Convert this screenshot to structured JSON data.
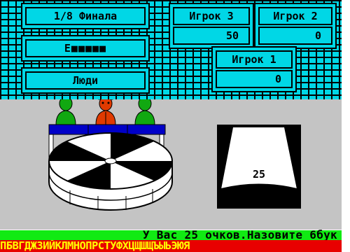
{
  "header": {
    "round": "1/8 Финала",
    "word": "Е■■■■■",
    "topic": "Люди"
  },
  "players": [
    {
      "label": "Игрок 3",
      "score": "50"
    },
    {
      "label": "Игрок 2",
      "score": "0"
    },
    {
      "label": "Игрок 1",
      "score": "0"
    }
  ],
  "drum": {
    "sector_value": "25"
  },
  "status": {
    "message": "У Вас 25 очков.Назовите 6бук"
  },
  "alphabet": "ПБВГДЖЗИЙКЛМНОПРСТУФХЦЩШЩЪЫЬЭЮЯ",
  "colors": {
    "grid_cyan": "#00d7e6",
    "floor_gray": "#c4c4c4",
    "player_green": "#11a811",
    "host_red": "#e03a00",
    "stand_blue": "#0000c8",
    "status_green": "#11ea13",
    "alphabet_red": "#e80000",
    "alphabet_yellow": "#ffff00"
  }
}
